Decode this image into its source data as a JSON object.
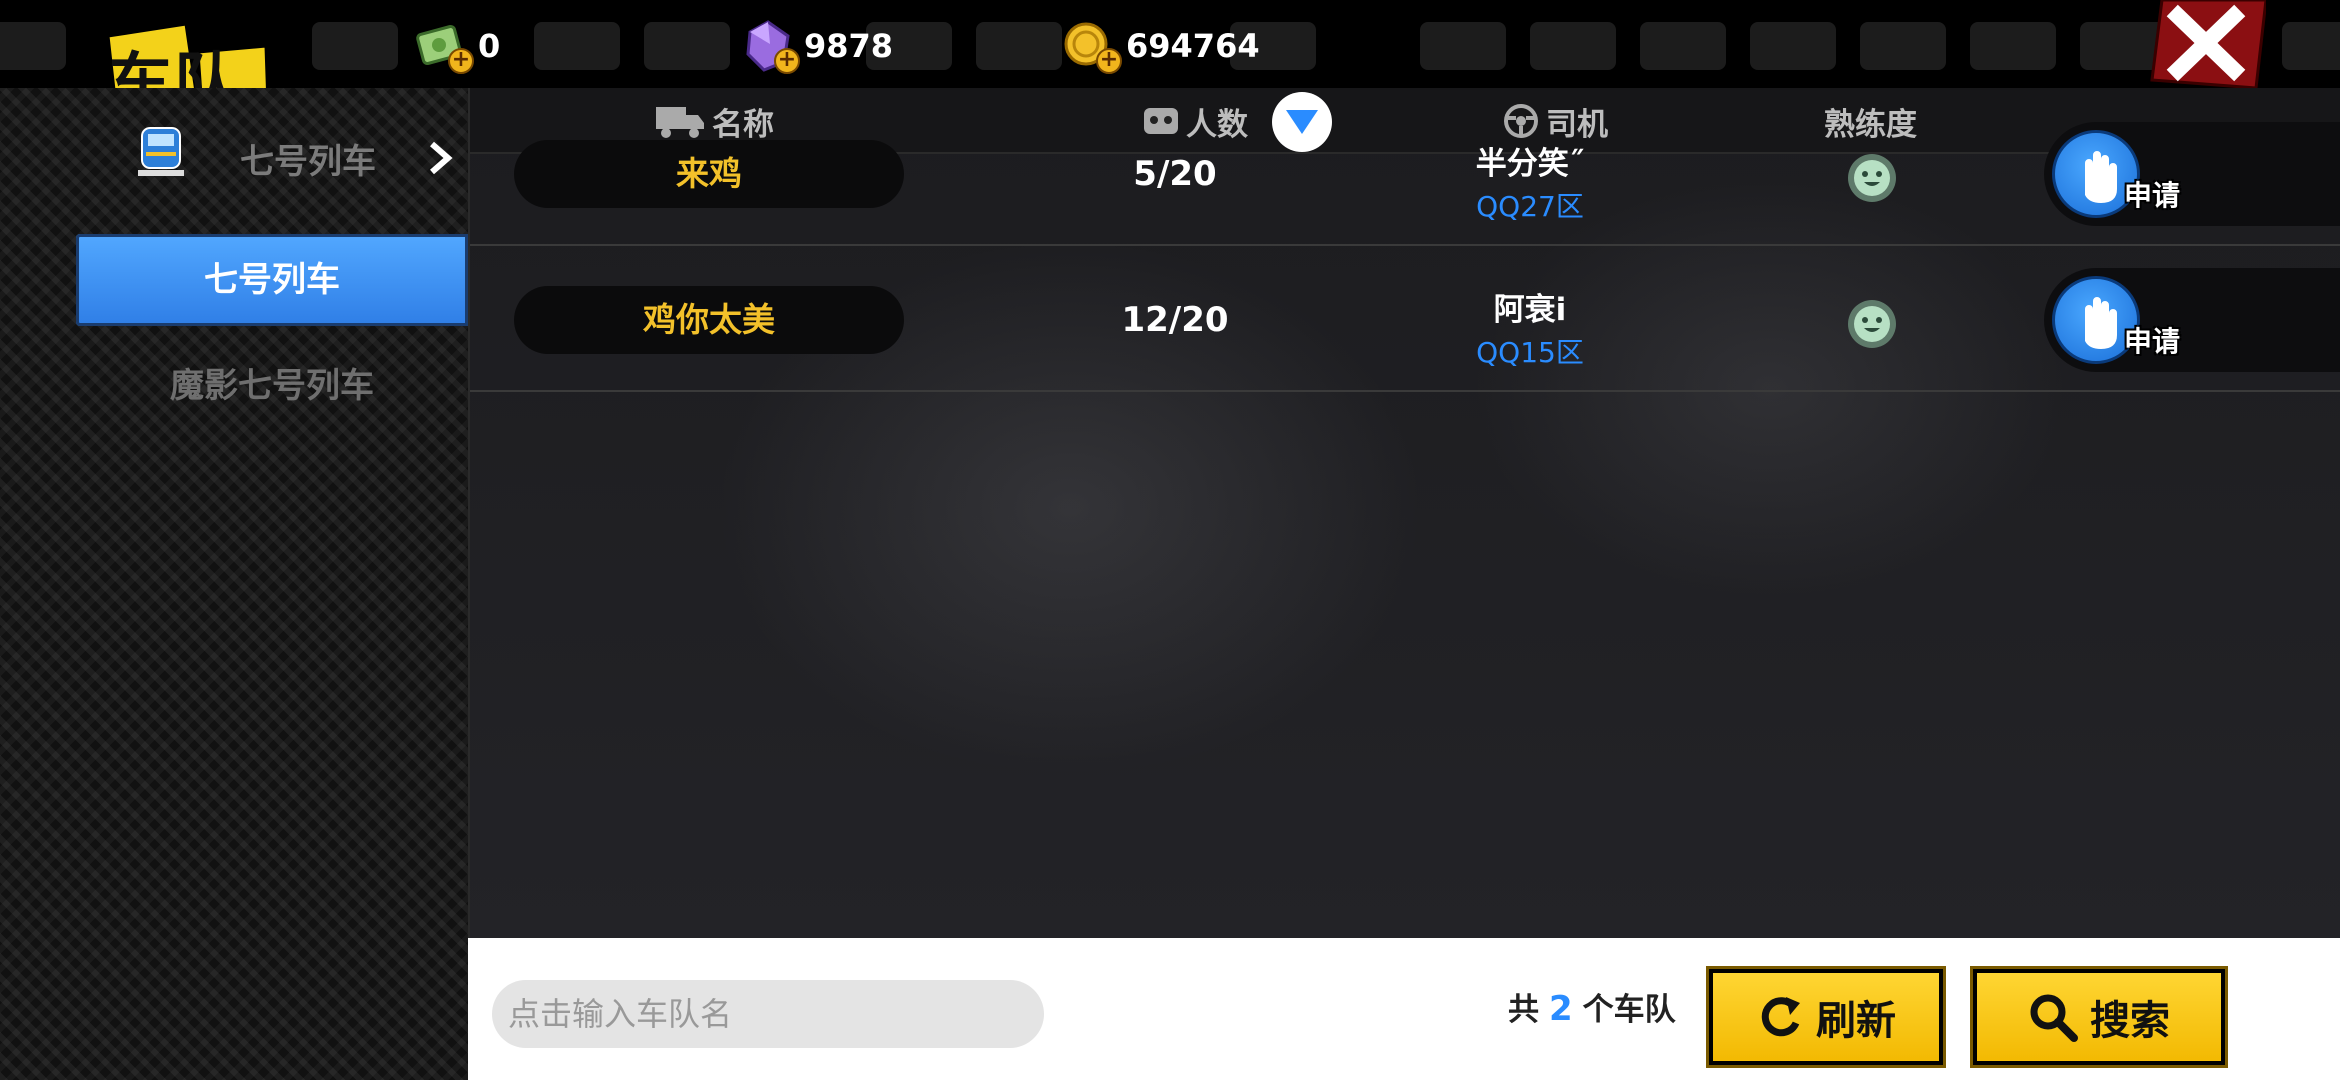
{
  "header": {
    "title": "车队",
    "currencies": [
      {
        "name": "cash",
        "value": "0"
      },
      {
        "name": "diamond",
        "value": "9878"
      },
      {
        "name": "coin",
        "value": "694764"
      }
    ]
  },
  "sidebar": {
    "group_label": "七号列车",
    "items": [
      {
        "label": "七号列车",
        "active": true
      },
      {
        "label": "魔影七号列车",
        "active": false
      }
    ]
  },
  "table": {
    "columns": {
      "name": "名称",
      "members": "人数",
      "driver": "司机",
      "skill": "熟练度"
    },
    "rows": [
      {
        "name": "来鸡",
        "members": "5/20",
        "driver": "半分笑˝",
        "server": "QQ27区",
        "apply": "申请"
      },
      {
        "name": "鸡你太美",
        "members": "12/20",
        "driver": "阿衰i",
        "server": "QQ15区",
        "apply": "申请"
      }
    ]
  },
  "footer": {
    "search_placeholder": "点击输入车队名",
    "total_prefix": "共",
    "total_count": "2",
    "total_suffix": "个车队",
    "refresh_label": "刷新",
    "search_label": "搜索"
  },
  "colors": {
    "accent_yellow": "#f3c12a",
    "accent_blue": "#2a8cff",
    "active_tab": "#3f93f5"
  }
}
